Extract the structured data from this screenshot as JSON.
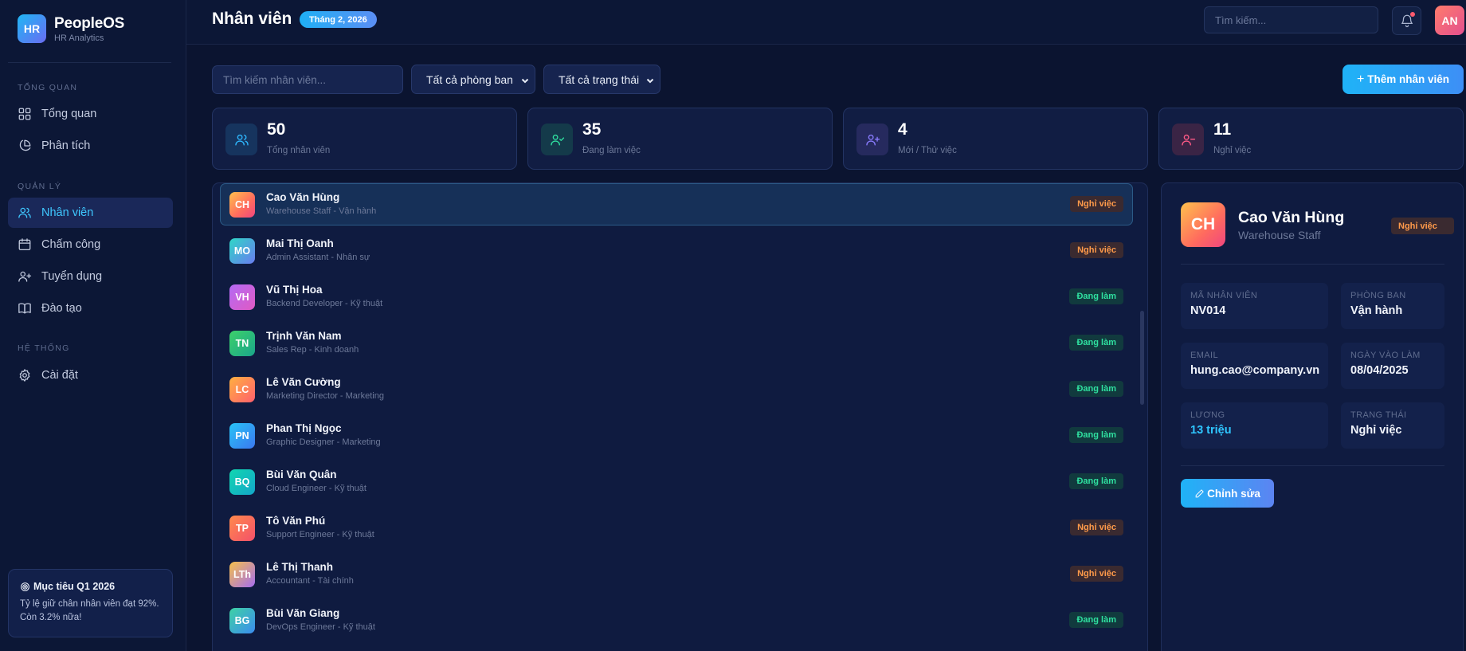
{
  "brand": {
    "logo": "HR",
    "name": "PeopleOS",
    "subtitle": "HR Analytics"
  },
  "sidebar": {
    "sections": [
      {
        "title": "TỔNG QUAN"
      },
      {
        "title": "QUẢN LÝ"
      },
      {
        "title": "HỆ THỐNG"
      }
    ],
    "items": [
      {
        "label": "Tổng quan",
        "icon": "grid-icon"
      },
      {
        "label": "Phân tích",
        "icon": "pie-chart-icon"
      },
      {
        "label": "Nhân viên",
        "icon": "users-icon",
        "active": true
      },
      {
        "label": "Chấm công",
        "icon": "calendar-icon"
      },
      {
        "label": "Tuyển dụng",
        "icon": "user-plus-icon"
      },
      {
        "label": "Đào tạo",
        "icon": "book-icon"
      },
      {
        "label": "Cài đặt",
        "icon": "gear-icon"
      }
    ],
    "goal": {
      "title": "Mục tiêu Q1 2026",
      "text": "Tỷ lệ giữ chân nhân viên đạt 92%. Còn 3.2% nữa!"
    }
  },
  "header": {
    "title": "Nhân viên",
    "month_badge": "Tháng 2, 2026",
    "search_placeholder": "Tìm kiếm...",
    "avatar": "AN"
  },
  "filters": {
    "search_placeholder": "Tìm kiếm nhân viên...",
    "department": "Tất cả phòng ban",
    "status": "Tất cả trạng thái",
    "add_button": "Thêm nhân viên"
  },
  "stats": [
    {
      "value": "50",
      "label": "Tổng nhân viên",
      "color": "#2fb8ff"
    },
    {
      "value": "35",
      "label": "Đang làm việc",
      "color": "#2fe0a0"
    },
    {
      "value": "4",
      "label": "Mới / Thử việc",
      "color": "#8a7cff"
    },
    {
      "value": "11",
      "label": "Nghỉ việc",
      "color": "#ff5a86"
    }
  ],
  "employees": [
    {
      "initials": "CH",
      "name": "Cao Văn Hùng",
      "sub": "Warehouse Staff - Vận hành",
      "status": "Nghỉ việc",
      "active": false,
      "selected": true
    },
    {
      "initials": "MO",
      "name": "Mai Thị Oanh",
      "sub": "Admin Assistant - Nhân sự",
      "status": "Nghỉ việc",
      "active": false
    },
    {
      "initials": "VH",
      "name": "Vũ Thị Hoa",
      "sub": "Backend Developer - Kỹ thuật",
      "status": "Đang làm",
      "active": true
    },
    {
      "initials": "TN",
      "name": "Trịnh Văn Nam",
      "sub": "Sales Rep - Kinh doanh",
      "status": "Đang làm",
      "active": true
    },
    {
      "initials": "LC",
      "name": "Lê Văn Cường",
      "sub": "Marketing Director - Marketing",
      "status": "Đang làm",
      "active": true
    },
    {
      "initials": "PN",
      "name": "Phan Thị Ngọc",
      "sub": "Graphic Designer - Marketing",
      "status": "Đang làm",
      "active": true
    },
    {
      "initials": "BQ",
      "name": "Bùi Văn Quân",
      "sub": "Cloud Engineer - Kỹ thuật",
      "status": "Đang làm",
      "active": true
    },
    {
      "initials": "TP",
      "name": "Tô Văn Phú",
      "sub": "Support Engineer - Kỹ thuật",
      "status": "Nghỉ việc",
      "active": false
    },
    {
      "initials": "LTh",
      "name": "Lê Thị Thanh",
      "sub": "Accountant - Tài chính",
      "status": "Nghỉ việc",
      "active": false
    },
    {
      "initials": "BG",
      "name": "Bùi Văn Giang",
      "sub": "DevOps Engineer - Kỹ thuật",
      "status": "Đang làm",
      "active": true
    }
  ],
  "detail": {
    "initials": "CH",
    "name": "Cao Văn Hùng",
    "role": "Warehouse Staff",
    "status": "Nghỉ việc",
    "fields": {
      "id_label": "MÃ NHÂN VIÊN",
      "id": "NV014",
      "dept_label": "PHÒNG BAN",
      "dept": "Vận hành",
      "email_label": "EMAIL",
      "email": "hung.cao@company.vn",
      "join_label": "NGÀY VÀO LÀM",
      "join": "08/04/2025",
      "salary_label": "LƯƠNG",
      "salary": "13 triệu",
      "state_label": "TRẠNG THÁI",
      "state": "Nghỉ việc"
    },
    "edit_button": "Chỉnh sửa"
  }
}
